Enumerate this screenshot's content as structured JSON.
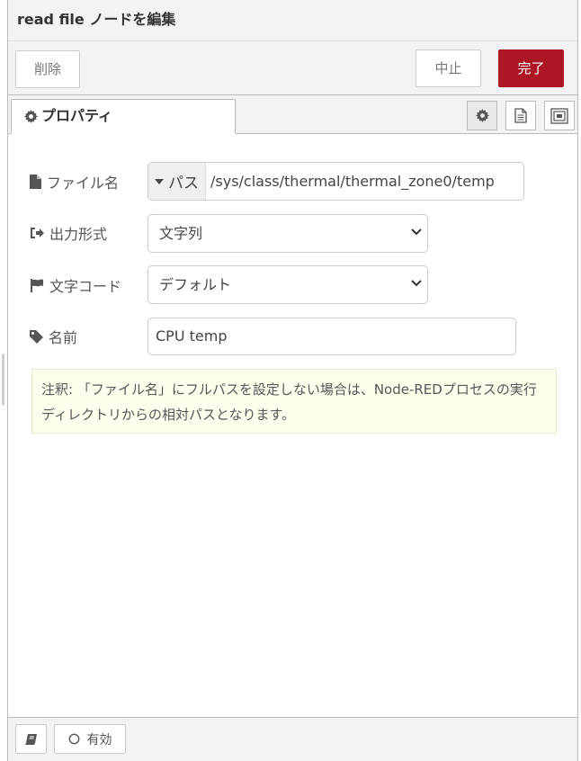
{
  "dialog": {
    "title": "read file ノードを編集"
  },
  "toolbar": {
    "delete_label": "削除",
    "cancel_label": "中止",
    "done_label": "完了",
    "accent": "#ad1625"
  },
  "tabs": {
    "properties_label": "プロパティ",
    "icons": [
      "gear-icon",
      "description-icon",
      "appearance-icon"
    ]
  },
  "form": {
    "filename": {
      "label": "ファイル名",
      "type_label": "パス",
      "value": "/sys/class/thermal/thermal_zone0/temp"
    },
    "format": {
      "label": "出力形式",
      "selected": "文字列"
    },
    "encoding": {
      "label": "文字コード",
      "selected": "デフォルト"
    },
    "name": {
      "label": "名前",
      "value": "CPU temp"
    }
  },
  "tip": {
    "text": "注釈: 「ファイル名」にフルパスを設定しない場合は、Node-REDプロセスの実行ディレクトリからの相対パスとなります。"
  },
  "footer": {
    "enabled_label": "有効"
  }
}
